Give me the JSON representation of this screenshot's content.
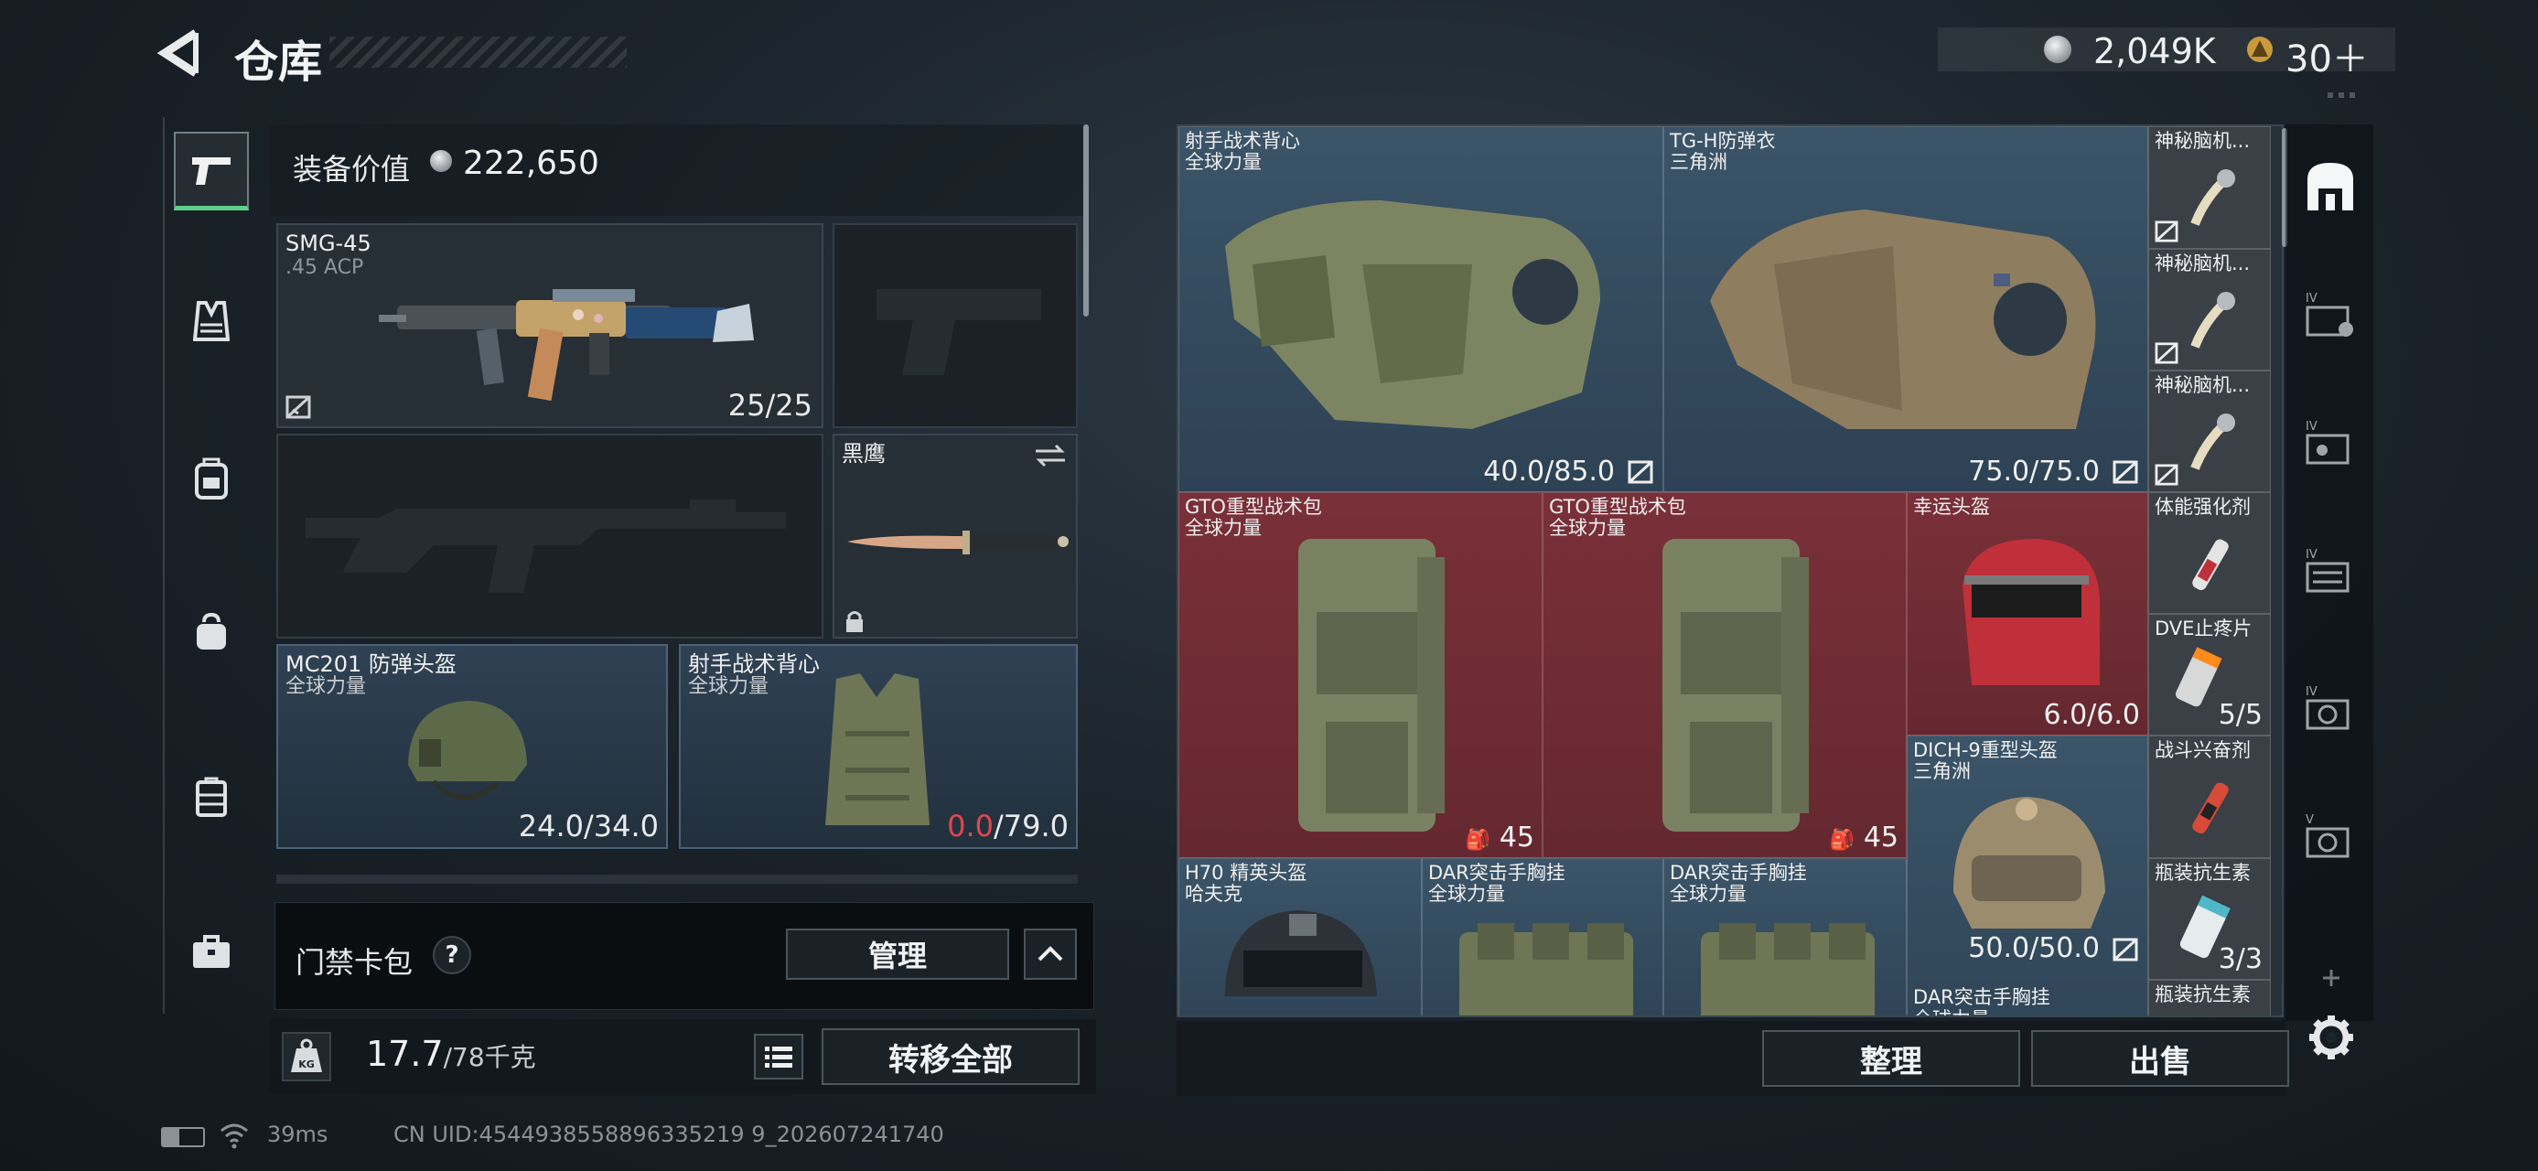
{
  "header": {
    "title": "仓库",
    "back": "back-arrow-icon"
  },
  "currency": {
    "coins": "2,049K",
    "tokens": "30＋"
  },
  "equipment_value": {
    "label": "装备价值",
    "value": "222,650"
  },
  "loadout": {
    "primary": {
      "name": "SMG-45",
      "ammo": ".45 ACP",
      "count": "25/25"
    },
    "melee": {
      "name": "黑鹰"
    },
    "helmet": {
      "name": "MC201 防弹头盔",
      "faction": "全球力量",
      "durability": "24.0/34.0"
    },
    "vest": {
      "name": "射手战术背心",
      "faction": "全球力量",
      "durability_current": "0.0",
      "durability_max": "/79.0"
    }
  },
  "card_pack": {
    "label": "门禁卡包",
    "help": "?",
    "manage": "管理"
  },
  "footer": {
    "weight": "17.7",
    "weight_max": "/78千克",
    "transfer_all": "转移全部",
    "weight_badge": "KG"
  },
  "status": {
    "ping": "39ms",
    "uid": "CN UID:4544938558896335219 9_202607241740"
  },
  "stash": {
    "items": [
      {
        "name": "射手战术背心",
        "sub": "全球力量",
        "value": "40.0/85.0"
      },
      {
        "name": "TG-H防弹衣",
        "sub": "三角洲",
        "value": "75.0/75.0"
      },
      {
        "name": "神秘脑机...",
        "sub": "",
        "value": ""
      },
      {
        "name": "神秘脑机...",
        "sub": "",
        "value": ""
      },
      {
        "name": "神秘脑机...",
        "sub": "",
        "value": ""
      },
      {
        "name": "GTO重型战术包",
        "sub": "全球力量",
        "value": "45"
      },
      {
        "name": "GTO重型战术包",
        "sub": "全球力量",
        "value": "45"
      },
      {
        "name": "幸运头盔",
        "sub": "",
        "value": "6.0/6.0"
      },
      {
        "name": "体能强化剂",
        "sub": "",
        "value": ""
      },
      {
        "name": "DVE止疼片",
        "sub": "",
        "value": "5/5"
      },
      {
        "name": "DICH-9重型头盔",
        "sub": "三角洲",
        "value": "50.0/50.0"
      },
      {
        "name": "战斗兴奋剂",
        "sub": "",
        "value": ""
      },
      {
        "name": "瓶装抗生素",
        "sub": "",
        "value": "3/3"
      },
      {
        "name": "H70 精英头盔",
        "sub": "哈夫克",
        "value": ""
      },
      {
        "name": "DAR突击手胸挂",
        "sub": "全球力量",
        "value": ""
      },
      {
        "name": "DAR突击手胸挂",
        "sub": "全球力量",
        "value": ""
      },
      {
        "name": "DAR突击手胸挂",
        "sub": "全球力量",
        "value": ""
      },
      {
        "name": "瓶装抗生素",
        "sub": "",
        "value": ""
      }
    ],
    "sort": "整理",
    "sell": "出售"
  },
  "colors": {
    "accent_green": "#5fd08a",
    "red_cell": "#7a3038",
    "blue_cell": "#3b5468",
    "warning_red": "#e0474c"
  }
}
